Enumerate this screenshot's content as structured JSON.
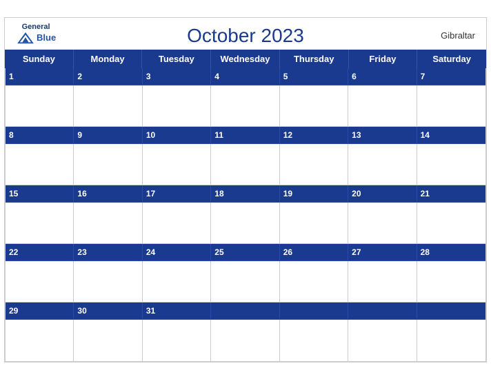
{
  "header": {
    "logo_general": "General",
    "logo_blue": "Blue",
    "title": "October 2023",
    "country": "Gibraltar"
  },
  "days": [
    "Sunday",
    "Monday",
    "Tuesday",
    "Wednesday",
    "Thursday",
    "Friday",
    "Saturday"
  ],
  "weeks": [
    {
      "dates": [
        "1",
        "2",
        "3",
        "4",
        "5",
        "6",
        "7"
      ]
    },
    {
      "dates": [
        "8",
        "9",
        "10",
        "11",
        "12",
        "13",
        "14"
      ]
    },
    {
      "dates": [
        "15",
        "16",
        "17",
        "18",
        "19",
        "20",
        "21"
      ]
    },
    {
      "dates": [
        "22",
        "23",
        "24",
        "25",
        "26",
        "27",
        "28"
      ]
    },
    {
      "dates": [
        "29",
        "30",
        "31",
        "",
        "",
        "",
        ""
      ]
    }
  ],
  "colors": {
    "header_bg": "#1a3a8f",
    "border": "#cccccc",
    "text_white": "#ffffff",
    "text_dark": "#333333"
  }
}
